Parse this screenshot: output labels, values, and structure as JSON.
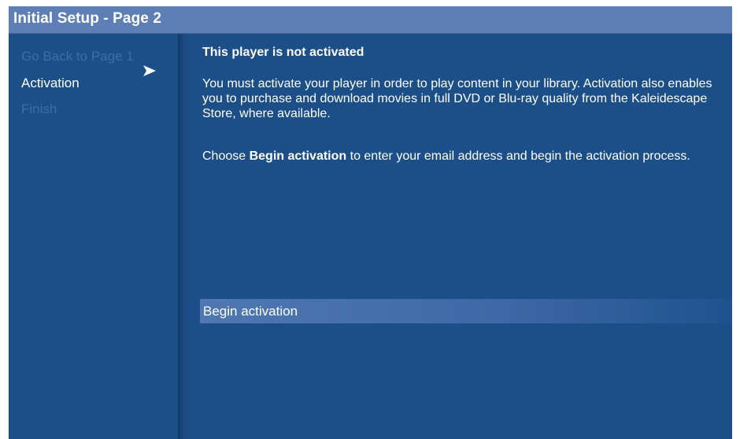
{
  "header": {
    "title": "Initial Setup - Page 2"
  },
  "sidebar": {
    "items": [
      {
        "label": "Go Back to Page 1",
        "state": "disabled"
      },
      {
        "label": "Activation",
        "state": "selected"
      },
      {
        "label": "Finish",
        "state": "disabled"
      }
    ],
    "selected_indicator_icon": "arrow-right-icon"
  },
  "main": {
    "heading": "This player is not activated",
    "paragraph1": "You must activate your player in order to play content in your library. Activation also enables you to purchase and download movies in full DVD or Blu-ray quality from the Kaleidescape Store, where available.",
    "paragraph2_prefix": "Choose ",
    "paragraph2_bold": "Begin activation",
    "paragraph2_suffix": " to enter your email address and begin the activation process.",
    "action_label": "Begin activation"
  },
  "colors": {
    "background": "#1c4f88",
    "titlebar": "#5d7fb5",
    "disabled_text": "#3e6ca4",
    "highlight": "#4f78b1",
    "text": "#ffffff"
  }
}
